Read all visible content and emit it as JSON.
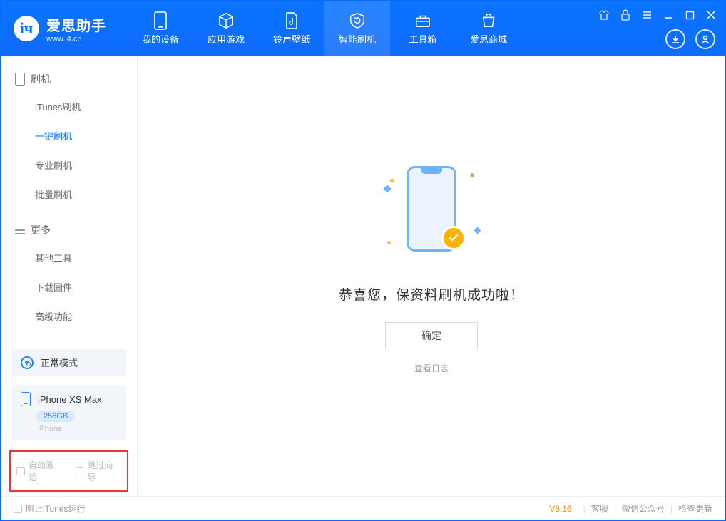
{
  "brand": {
    "title": "爱思助手",
    "subtitle": "www.i4.cn",
    "logo_letter": "iч"
  },
  "tabs": [
    {
      "label": "我的设备",
      "icon": "device"
    },
    {
      "label": "应用游戏",
      "icon": "cube"
    },
    {
      "label": "铃声壁纸",
      "icon": "music"
    },
    {
      "label": "智能刷机",
      "icon": "refresh",
      "active": true
    },
    {
      "label": "工具箱",
      "icon": "toolbox"
    },
    {
      "label": "爱思商城",
      "icon": "store"
    }
  ],
  "sidebar": {
    "group1_title": "刷机",
    "group1_items": [
      "iTunes刷机",
      "一键刷机",
      "专业刷机",
      "批量刷机"
    ],
    "group1_active_index": 1,
    "group2_title": "更多",
    "group2_items": [
      "其他工具",
      "下载固件",
      "高级功能"
    ]
  },
  "device_status": {
    "label": "正常模式"
  },
  "device": {
    "name": "iPhone XS Max",
    "storage": "256GB",
    "type": "iPhone"
  },
  "options": {
    "auto_activate": "自动激活",
    "skip_guide": "跳过向导"
  },
  "main": {
    "success_title": "恭喜您，保资料刷机成功啦！",
    "ok_button": "确定",
    "log_link": "查看日志"
  },
  "footer": {
    "block_itunes": "阻止iTunes运行",
    "version": "V8.16",
    "links": [
      "客服",
      "微信公众号",
      "检查更新"
    ]
  }
}
